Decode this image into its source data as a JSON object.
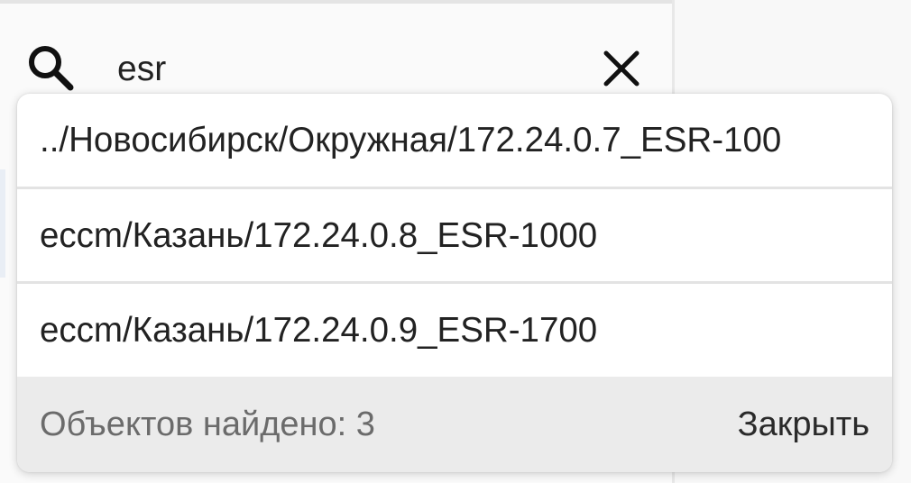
{
  "search": {
    "value": "esr",
    "icon": "search-icon",
    "clear_icon": "close-icon"
  },
  "results": [
    {
      "path": "../Новосибирск/Окружная/172.24.0.7_ESR-100"
    },
    {
      "path": "eccm/Казань/172.24.0.8_ESR-1000"
    },
    {
      "path": "eccm/Казань/172.24.0.9_ESR-1700"
    }
  ],
  "footer": {
    "found_label": "Объектов найдено: 3",
    "close_label": "Закрыть"
  },
  "colors": {
    "popup_background": "#ffffff",
    "footer_background": "#ebebeb",
    "found_text": "#6b6b6b",
    "text": "#222222"
  }
}
